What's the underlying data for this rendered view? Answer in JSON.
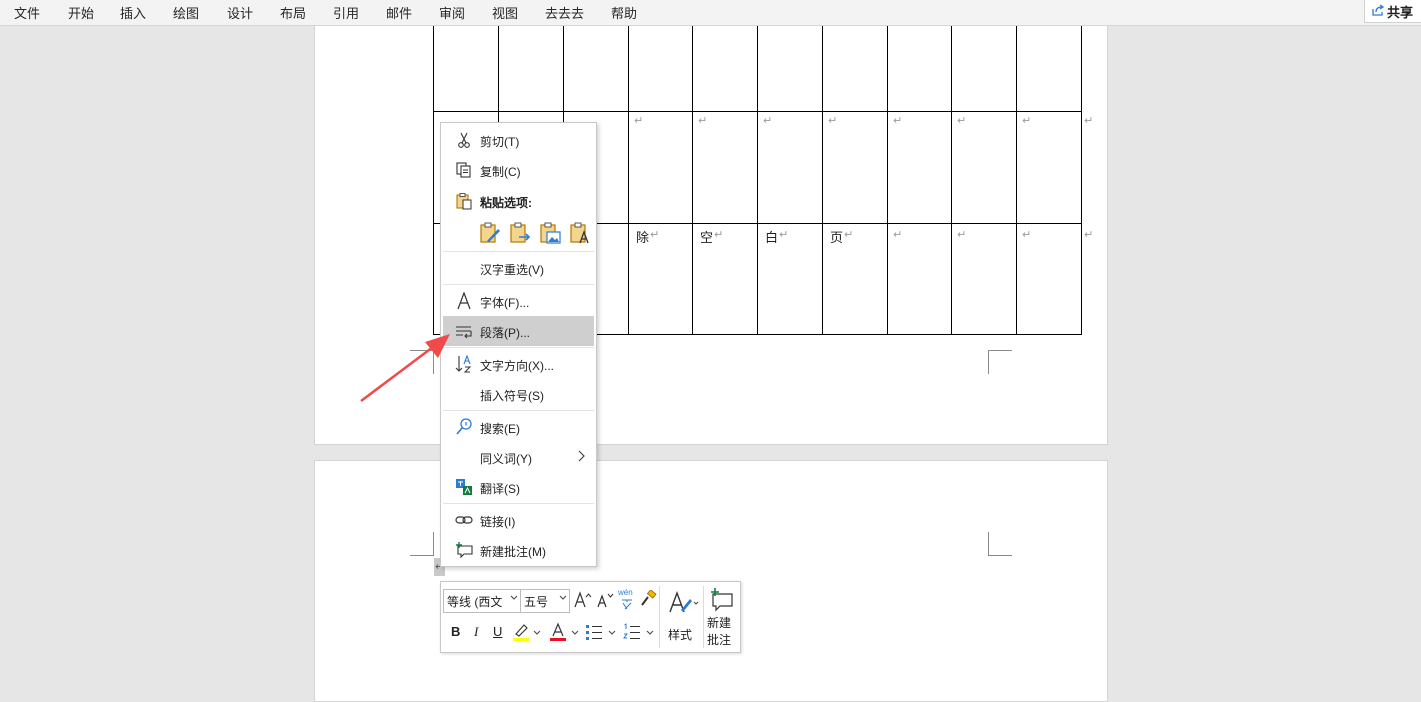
{
  "menubar": {
    "tabs": [
      "文件",
      "开始",
      "插入",
      "绘图",
      "设计",
      "布局",
      "引用",
      "邮件",
      "审阅",
      "视图",
      "去去去",
      "帮助"
    ],
    "share": "共享"
  },
  "document": {
    "row3_cells": [
      "除",
      "空",
      "白",
      "页"
    ],
    "return_mark": "↵"
  },
  "context_menu": {
    "cut": "剪切(T)",
    "copy": "复制(C)",
    "paste_options": "粘贴选项:",
    "reconvert": "汉字重选(V)",
    "font": "字体(F)...",
    "paragraph": "段落(P)...",
    "text_direction": "文字方向(X)...",
    "insert_symbol": "插入符号(S)",
    "search": "搜索(E)",
    "synonyms": "同义词(Y)",
    "translate": "翻译(S)",
    "link": "链接(I)",
    "new_comment": "新建批注(M)"
  },
  "mini_toolbar": {
    "font_name": "等线 (西文",
    "font_size": "五号",
    "bold": "B",
    "italic": "I",
    "underline": "U",
    "styles": "样式",
    "new_comment_line1": "新建",
    "new_comment_line2": "批注",
    "phonetic": "wén"
  },
  "colors": {
    "highlight": "#ffff00",
    "font_color": "#e81123",
    "arrow": "#f04a4a",
    "accent": "#2b7cd3"
  }
}
